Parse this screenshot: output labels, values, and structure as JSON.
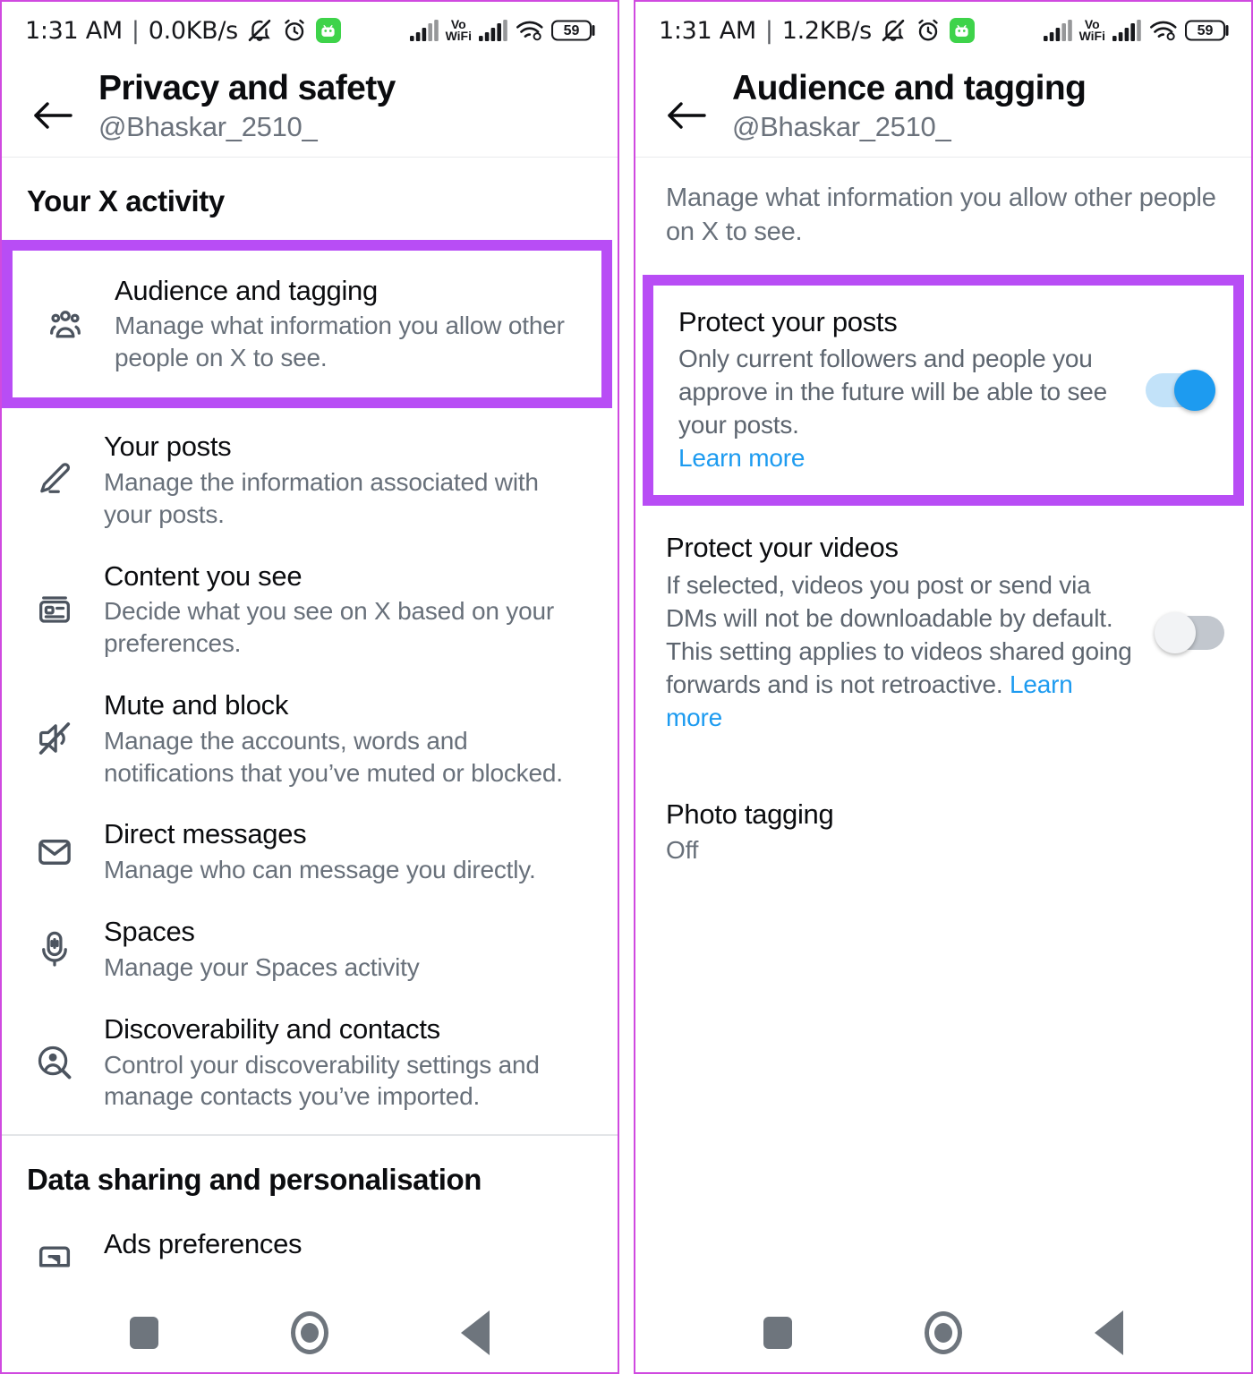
{
  "left": {
    "statusbar": {
      "time": "1:31 AM",
      "separator": "|",
      "data_rate": "0.0KB/s",
      "icons": [
        "bell-muted-icon",
        "alarm-icon",
        "green-app-badge-icon"
      ],
      "network": {
        "vo": "Vo",
        "wifi": "WiFi",
        "battery": "59"
      }
    },
    "header": {
      "back_label": "Back",
      "title": "Privacy and safety",
      "handle": "@Bhaskar_2510_"
    },
    "sections": [
      {
        "title": "Your X activity",
        "items": [
          {
            "icon": "audience-people-icon",
            "title": "Audience and tagging",
            "desc": "Manage what information you allow other people on X to see.",
            "highlighted": true
          },
          {
            "icon": "pencil-icon",
            "title": "Your posts",
            "desc": "Manage the information associated with your posts.",
            "highlighted": false
          },
          {
            "icon": "content-card-icon",
            "title": "Content you see",
            "desc": "Decide what you see on X based on your preferences.",
            "highlighted": false
          },
          {
            "icon": "speaker-mute-icon",
            "title": "Mute and block",
            "desc": "Manage the accounts, words and notifications that you’ve muted or blocked.",
            "highlighted": false
          },
          {
            "icon": "envelope-icon",
            "title": "Direct messages",
            "desc": "Manage who can message you directly.",
            "highlighted": false
          },
          {
            "icon": "microphone-icon",
            "title": "Spaces",
            "desc": "Manage your Spaces activity",
            "highlighted": false
          },
          {
            "icon": "person-search-icon",
            "title": "Discoverability and contacts",
            "desc": "Control your discoverability settings and manage contacts you’ve imported.",
            "highlighted": false
          }
        ]
      },
      {
        "title": "Data sharing and personalisation",
        "items": [
          {
            "icon": "ads-display-icon",
            "title": "Ads preferences",
            "desc": "",
            "highlighted": false
          }
        ]
      }
    ]
  },
  "right": {
    "statusbar": {
      "time": "1:31 AM",
      "separator": "|",
      "data_rate": "1.2KB/s",
      "icons": [
        "bell-muted-icon",
        "alarm-icon",
        "green-app-badge-icon"
      ],
      "network": {
        "vo": "Vo",
        "wifi": "WiFi",
        "battery": "59"
      }
    },
    "header": {
      "back_label": "Back",
      "title": "Audience and tagging",
      "handle": "@Bhaskar_2510_"
    },
    "intro": "Manage what information you allow other people on X to see.",
    "settings": [
      {
        "title": "Protect your posts",
        "desc": "Only current followers and people you approve in the future will be able to see your posts.",
        "link": "Learn more",
        "toggle": "on",
        "highlighted": true
      },
      {
        "title": "Protect your videos",
        "desc": "If selected, videos you post or send via DMs will not be downloadable by default. This setting applies to videos shared going forwards and is not retroactive.",
        "link": "Learn more",
        "toggle": "off",
        "highlighted": false
      },
      {
        "title": "Photo tagging",
        "value": "Off",
        "toggle": "none",
        "highlighted": false
      }
    ]
  },
  "navbar": {
    "recents_label": "Recents",
    "home_label": "Home",
    "back_label": "Back"
  },
  "colors": {
    "highlight": "#b84df5",
    "frame": "#d04ae0",
    "toggle_on": "#1d9bf0",
    "link": "#1d9bf0",
    "status_green": "#3ed34a"
  }
}
